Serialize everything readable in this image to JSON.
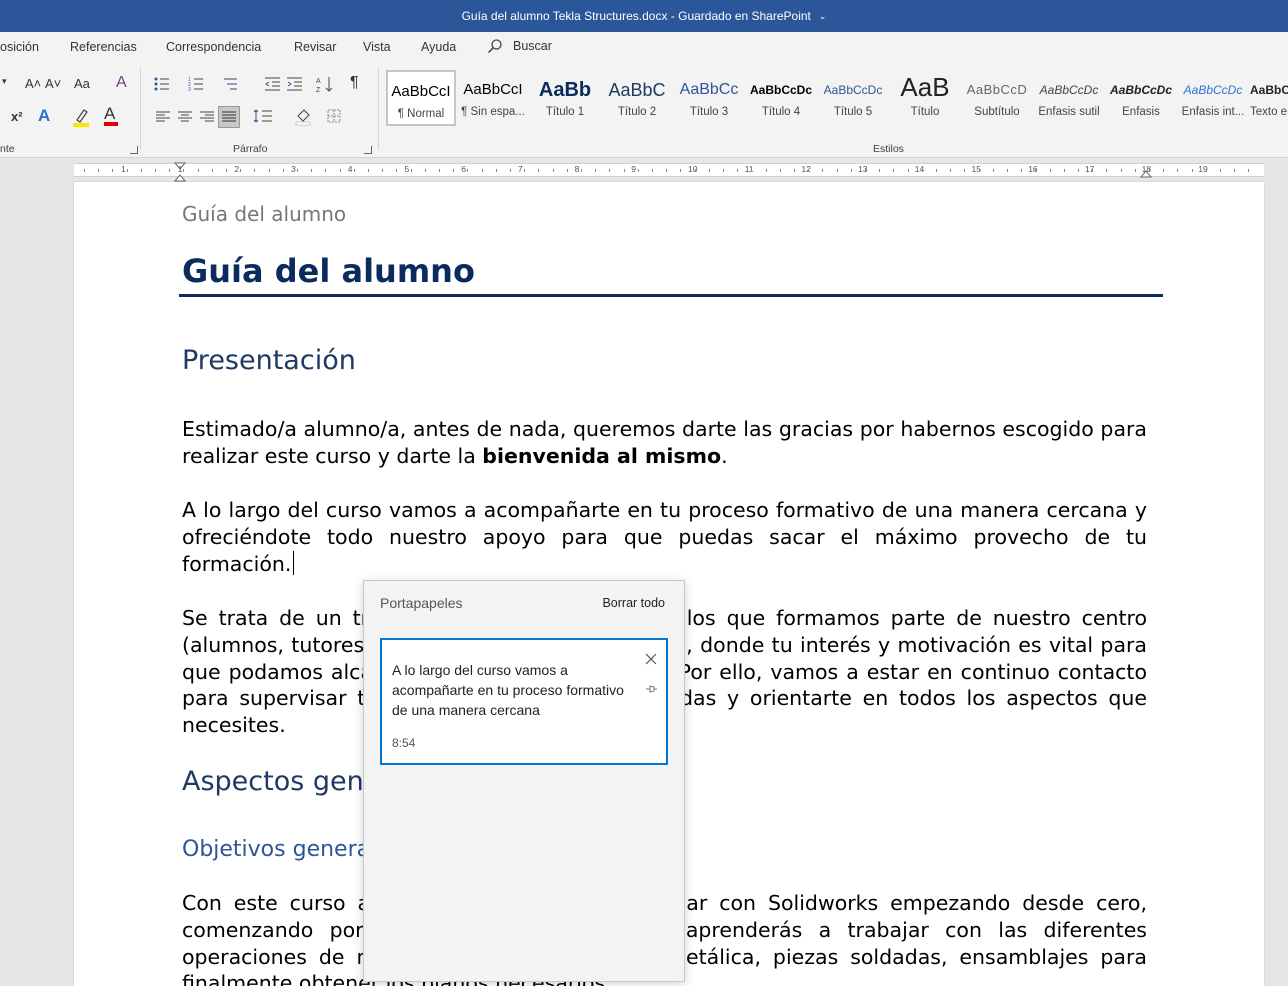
{
  "window": {
    "title": "Guía del alumno Tekla Structures.docx  -  Guardado en SharePoint",
    "caret": "⌄"
  },
  "menu": {
    "tabs": [
      "osición",
      "Referencias",
      "Correspondencia",
      "Revisar",
      "Vista",
      "Ayuda"
    ],
    "search_label": "Buscar"
  },
  "ribbon": {
    "font_group_label": "nte",
    "paragraph_group_label": "Párrafo",
    "styles_group_label": "Estilos",
    "font_size_up": "A˄",
    "font_size_down": "A˅",
    "change_case": "Aa",
    "superscript": "x²",
    "pilcrow": "¶",
    "styles": [
      {
        "preview": "AaBbCcI",
        "label": "¶ Normal"
      },
      {
        "preview": "AaBbCcI",
        "label": "¶ Sin espa..."
      },
      {
        "preview": "AaBb",
        "label": "Título 1"
      },
      {
        "preview": "AaBbC",
        "label": "Título 2"
      },
      {
        "preview": "AaBbCc",
        "label": "Título 3"
      },
      {
        "preview": "AaBbCcDc",
        "label": "Título 4"
      },
      {
        "preview": "AaBbCcDc",
        "label": "Título 5"
      },
      {
        "preview": "AaB",
        "label": "Título"
      },
      {
        "preview": "AaBbCcD",
        "label": "Subtítulo"
      },
      {
        "preview": "AaBbCcDc",
        "label": "Énfasis sutil"
      },
      {
        "preview": "AaBbCcDc",
        "label": "Énfasis"
      },
      {
        "preview": "AaBbCcDc",
        "label": "Énfasis int..."
      },
      {
        "preview": "AaBbCcDc",
        "label": "Texto e"
      }
    ]
  },
  "ruler": {
    "numbers": [
      "1",
      "1",
      "2",
      "3",
      "4",
      "5",
      "6",
      "7",
      "8",
      "9",
      "10",
      "11",
      "12",
      "13",
      "14",
      "15",
      "16",
      "17",
      "18",
      "19"
    ]
  },
  "document": {
    "header": "Guía del alumno",
    "title": "Guía del alumno",
    "h_presentacion": "Presentación",
    "p1_a": "Estimado/a alumno/a, antes de nada, queremos darte las gracias por habernos escogido para realizar este curso y darte la ",
    "p1_bold": "bienvenida al mismo",
    "p1_end": ".",
    "p2": "A lo largo del curso vamos a acompañarte en tu proceso formativo de una manera cercana y ofreciéndote todo nuestro apoyo para que puedas sacar el máximo provecho de tu formación.",
    "p3": "Se trata de un trabajo en equipo entre todos los que formamos parte de nuestro centro (alumnos, tutores, coordinadores, personal, etc.), donde tu interés y motivación es vital para que podamos alcanzar los objetivos marcados. Por ello, vamos a estar en continuo contacto para supervisar tus progresos, resolver tus dudas y orientarte en todos los aspectos que necesites.",
    "h_aspectos": "Aspectos generales",
    "h_objetivos": "Objetivos generales",
    "p4": "Con este curso aprenderás a diseñar y modelar con Solidworks empezando desde cero, comenzando por el croquizado, para luego aprenderás a trabajar con las diferentes operaciones de modelado, piezas de chapa metálica, piezas soldadas, ensamblajes para finalmente obtener los planos necesarios."
  },
  "clipboard": {
    "title": "Portapapeles",
    "clear_all": "Borrar todo",
    "item_text": "A lo largo del curso vamos a acompañarte en tu proceso formativo de una manera cercana",
    "item_time": "8:54"
  }
}
